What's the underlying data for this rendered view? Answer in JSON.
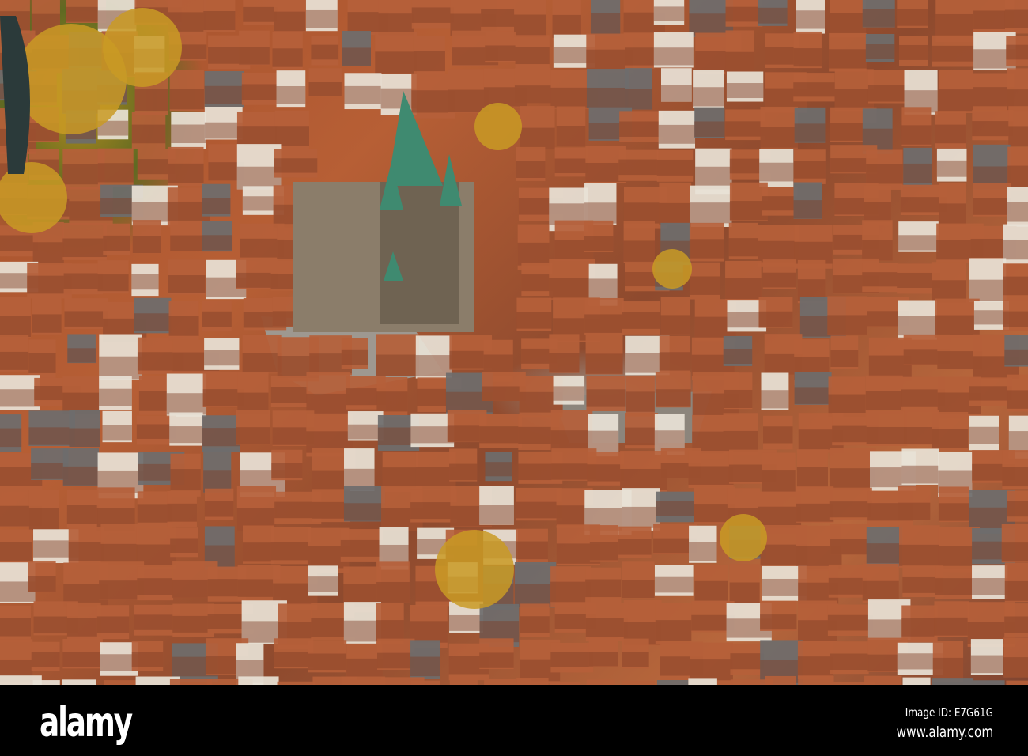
{
  "photo": {
    "subject": "aerial view of old town with church",
    "colors": {
      "roof": "#b5603a",
      "roof_dark": "#7e3e26",
      "wall": "#e8e2d6",
      "spire": "#3f8a70",
      "tree": "#c99a25",
      "square": "#9e9890"
    }
  },
  "watermark": {
    "logo": "alamy",
    "image_id": "Image ID: E7G61G",
    "url": "www.alamy.com"
  }
}
